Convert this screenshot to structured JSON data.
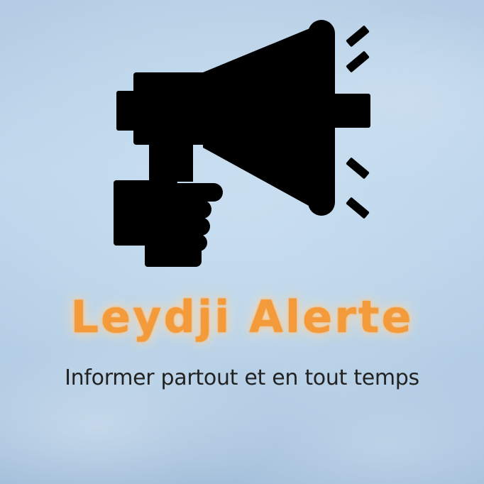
{
  "brand": {
    "name": "Leydji Alerte",
    "tagline": "Informer partout et en tout temps"
  },
  "logo": {
    "icon": "megaphone-in-hand-icon"
  },
  "colors": {
    "background": "#bcd3ea",
    "title": "#f39a3a",
    "title_glow": "#ffe3c4",
    "tagline": "#222222",
    "icon": "#000000"
  }
}
